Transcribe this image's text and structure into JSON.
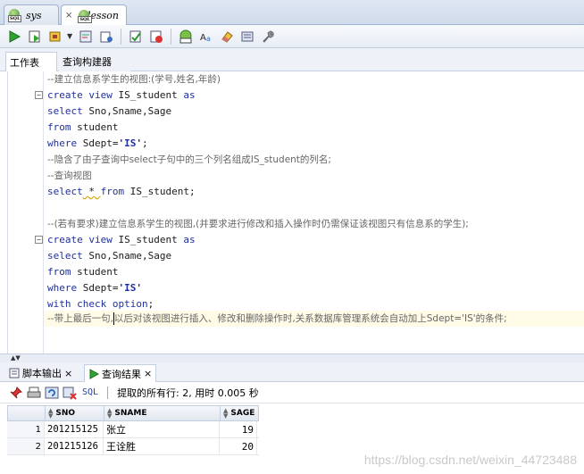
{
  "doc_tabs": [
    {
      "label": "sys",
      "active": false
    },
    {
      "label": "lesson",
      "active": true
    }
  ],
  "worksheet_tabs": [
    "工作表",
    "查询构建器"
  ],
  "editor_lines": [
    "--建立信息系学生的视图:(学号,姓名,年龄)",
    "create view IS_student as",
    "select Sno,Sname,Sage",
    "from student",
    "where Sdept='IS';",
    "--隐含了由子查询中select子句中的三个列名组成IS_student的列名;",
    "--查询视图",
    "select * from IS_student;",
    "",
    "--(若有要求)建立信息系学生的视图,(并要求进行修改和插入操作时仍需保证该视图只有信息系的学生);",
    "create view IS_student as",
    "select Sno,Sname,Sage",
    "from student",
    "where Sdept='IS'",
    "with check option;",
    "--带上最后一句,以后对该视图进行插入、修改和删除操作时,关系数据库管理系统会自动加上Sdept='IS'的条件;"
  ],
  "code": {
    "l1_kw": "create view",
    "l1_rest": " IS_student ",
    "l1_as": "as",
    "l2_kw": "select",
    "l2_rest": " Sno,Sname,Sage",
    "l3_kw": "from",
    "l3_rest": " student",
    "l4_kw": "where",
    "l4_rest": " Sdept=",
    "l4_str": "'IS'",
    "l4_end": ";",
    "l7_kw": "select",
    "l7_star": " * ",
    "l7_from": "from",
    "l7_rest": " IS_student;",
    "l13_str": "'IS'",
    "l14_kw": "with check option",
    "l14_end": ";",
    "l15_a": "--带上最后一句,",
    "l15_b": "以后对该视图进行插入、修改和删除操作时,关系数据库管理系统会自动加上Sdept='IS'的条件;"
  },
  "bottom_tabs": [
    {
      "label": "脚本输出",
      "close": "×"
    },
    {
      "label": "查询结果",
      "close": "×"
    }
  ],
  "result_toolbar": {
    "sql_label": "SQL",
    "status": "提取的所有行: 2, 用时 0.005 秒"
  },
  "results": {
    "columns": [
      "SNO",
      "SNAME",
      "SAGE"
    ],
    "rows": [
      {
        "n": "1",
        "sno": "201215125",
        "sname": "张立",
        "sage": "19"
      },
      {
        "n": "2",
        "sno": "201215126",
        "sname": "王诠胜",
        "sage": "20"
      }
    ]
  },
  "watermark": "https://blog.csdn.net/weixin_44723488",
  "colors": {
    "keyword": "#1f2f9e",
    "comment": "#666666",
    "highlight_line": "#fffbe6"
  }
}
